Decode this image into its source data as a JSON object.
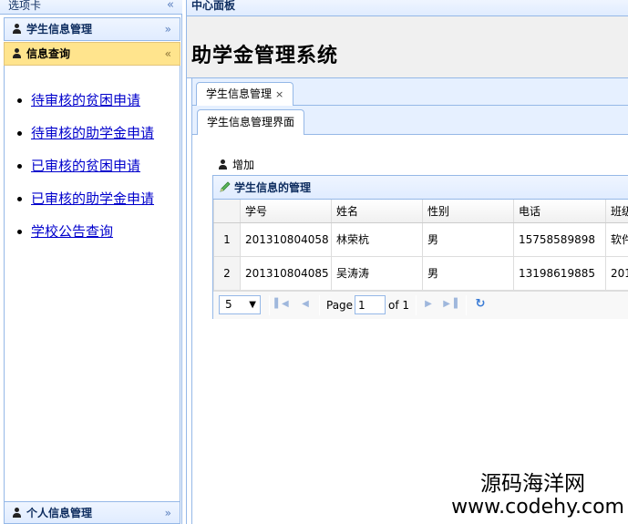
{
  "west": {
    "title": "选项卡",
    "collapse_glyph": "«",
    "sections": [
      {
        "label": "学生信息管理",
        "chevron": "»",
        "selected": false
      },
      {
        "label": "信息查询",
        "chevron": "«",
        "selected": true
      },
      {
        "label": "个人信息管理",
        "chevron": "»",
        "selected": false
      }
    ],
    "links": [
      "待审核的贫困申请",
      "待审核的助学金申请",
      "已审核的贫困申请",
      "已审核的助学金申请",
      "学校公告查询"
    ]
  },
  "center": {
    "title": "中心面板",
    "app_title": "助学金管理系统",
    "tab": {
      "label": "学生信息管理",
      "close": "×"
    },
    "subtab": {
      "label": "学生信息管理界面"
    }
  },
  "toolbar": {
    "add_label": "增加"
  },
  "grid": {
    "title": "学生信息的管理",
    "columns": [
      "学号",
      "姓名",
      "性别",
      "电话",
      "班级"
    ],
    "rows": [
      {
        "num": "1",
        "cells": [
          "201310804058",
          "林荣杭",
          "男",
          "15758589898",
          "软件"
        ]
      },
      {
        "num": "2",
        "cells": [
          "201310804085",
          "吴涛涛",
          "男",
          "13198619885",
          "201"
        ]
      }
    ],
    "pager": {
      "page_size": "5",
      "page_label": "Page",
      "page_value": "1",
      "of_label": "of 1"
    }
  },
  "watermark": {
    "line1": "源码海洋网",
    "line2": "www.codehy.com"
  },
  "colors": {
    "border": "#95b8e7",
    "header_bg": "#e0ecff",
    "selected_bg": "#ffe48d",
    "link": "#0000cc"
  }
}
